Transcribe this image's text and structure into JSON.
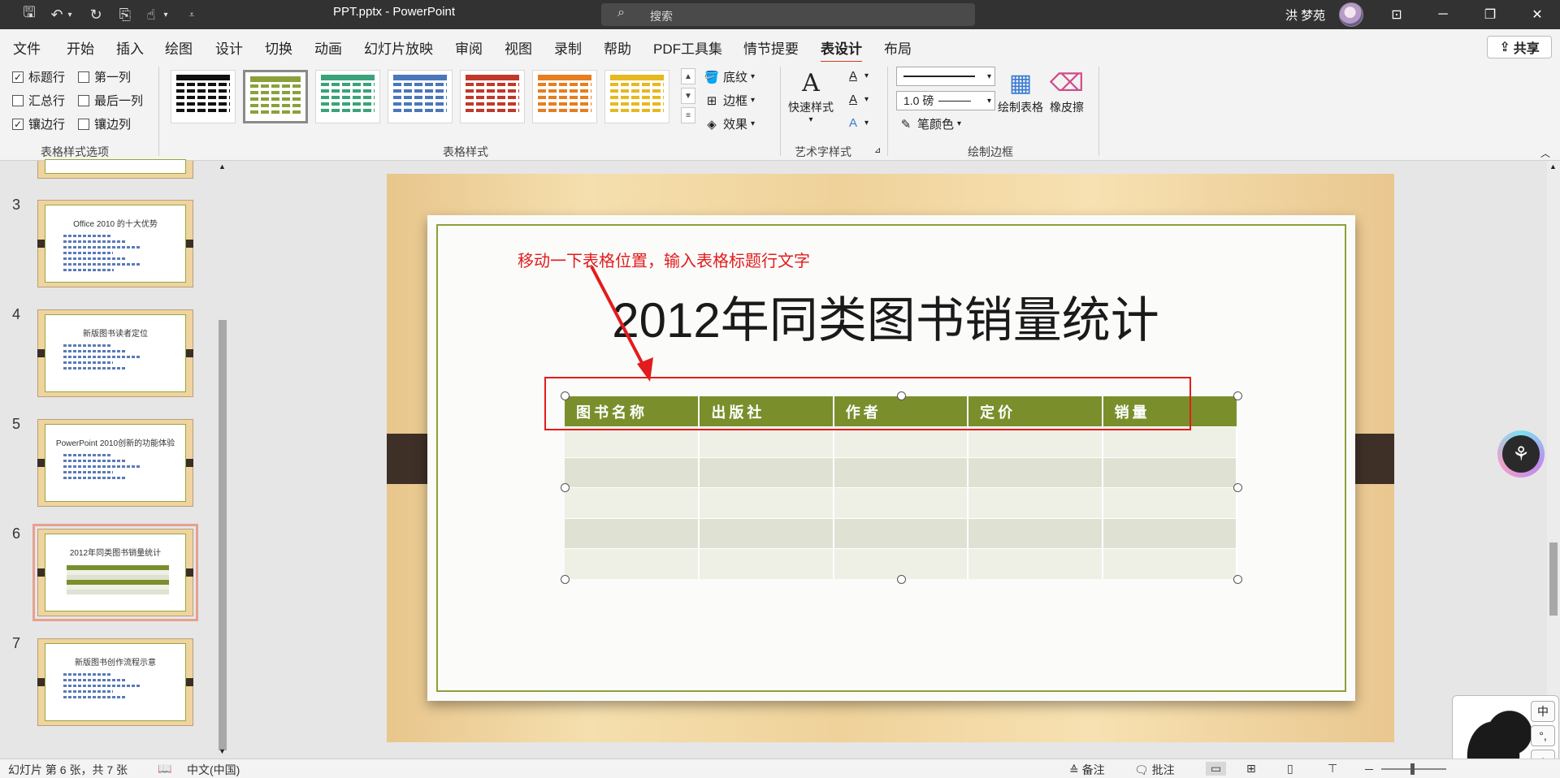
{
  "titlebar": {
    "doc_title": "PPT.pptx  -  PowerPoint",
    "search_placeholder": "搜索",
    "user_name": "洪 梦苑"
  },
  "ribbon_tabs": [
    "文件",
    "开始",
    "插入",
    "绘图",
    "设计",
    "切换",
    "动画",
    "幻灯片放映",
    "审阅",
    "视图",
    "录制",
    "帮助",
    "PDF工具集",
    "情节提要",
    "表设计",
    "布局"
  ],
  "active_tab": "表设计",
  "share_label": "共享",
  "style_options": {
    "label": "表格样式选项",
    "items": [
      {
        "label": "标题行",
        "checked": true
      },
      {
        "label": "第一列",
        "checked": false
      },
      {
        "label": "汇总行",
        "checked": false
      },
      {
        "label": "最后一列",
        "checked": false
      },
      {
        "label": "镶边行",
        "checked": true
      },
      {
        "label": "镶边列",
        "checked": false
      }
    ]
  },
  "table_styles": {
    "label": "表格样式",
    "colors": [
      "#111111",
      "#8aa13a",
      "#3aa37a",
      "#4a78b8",
      "#c0392b",
      "#e67e22",
      "#e6b822"
    ],
    "selected_index": 1,
    "shading_label": "底纹",
    "borders_label": "边框",
    "effects_label": "效果"
  },
  "wordart": {
    "label": "艺术字样式",
    "quick_styles_label": "快速样式"
  },
  "draw_borders": {
    "label": "绘制边框",
    "pen_weight": "1.0 磅",
    "pen_color_label": "笔颜色",
    "draw_table_label": "绘制表格",
    "eraser_label": "橡皮擦"
  },
  "thumbnails": [
    {
      "num": "3",
      "title": "Office 2010 的十大优势"
    },
    {
      "num": "4",
      "title": "新版图书读者定位"
    },
    {
      "num": "5",
      "title": "PowerPoint 2010创新的功能体验"
    },
    {
      "num": "6",
      "title": "2012年同类图书销量统计"
    },
    {
      "num": "7",
      "title": "新版图书创作流程示意"
    }
  ],
  "slide": {
    "annotation": "移动一下表格位置，输入表格标题行文字",
    "title": "2012年同类图书销量统计",
    "table_headers": [
      "图书名称",
      "出版社",
      "作者",
      "定价",
      "销量"
    ]
  },
  "ime": {
    "key1": "中",
    "key2": "°,",
    "key3": "⌂"
  },
  "statusbar": {
    "slide_info": "幻灯片 第 6 张，共 7 张",
    "language": "中文(中国)",
    "notes": "备注",
    "comments": "批注"
  }
}
